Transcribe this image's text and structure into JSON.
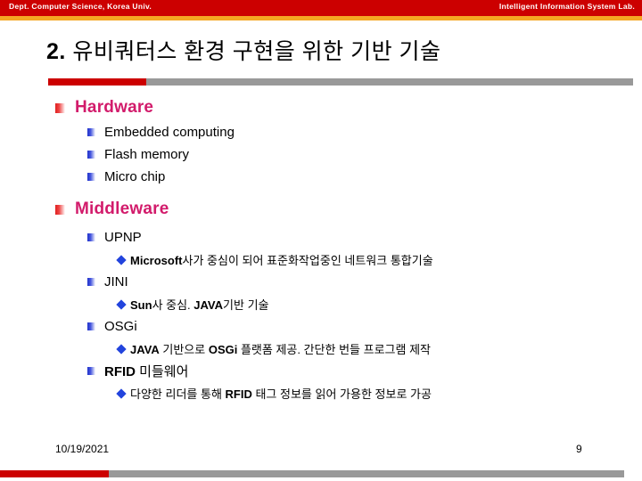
{
  "header": {
    "left_label": "Dept. Computer Science, Korea Univ.",
    "right_label": "Intelligent Information System Lab.",
    "bar_color": "#CC0000",
    "accent_color": "#F5A623"
  },
  "title": {
    "number": "2.",
    "text": "유비쿼터스 환경 구현을 위한 기반 기술"
  },
  "rule": {
    "red_color": "#CC0000",
    "gray_color": "#999999"
  },
  "content": {
    "hardware": {
      "label": "Hardware",
      "items": [
        {
          "label": "Embedded computing"
        },
        {
          "label": "Flash memory"
        },
        {
          "label": "Micro chip"
        }
      ]
    },
    "middleware": {
      "label": "Middleware",
      "items": [
        {
          "label": "UPNP",
          "detail_bold": "Microsoft",
          "detail_rest": "사가 중심이 되어 표준화작업중인 네트워크 통합기술"
        },
        {
          "label": "JINI",
          "detail_bold": "Sun",
          "detail_mid": "사 중심. ",
          "detail_bold2": "JAVA",
          "detail_rest": "기반 기술"
        },
        {
          "label": "OSGi",
          "detail_bold": "JAVA",
          "detail_mid": " 기반으로 ",
          "detail_bold2": "OSGi",
          "detail_rest": " 플랫폼 제공. 간단한 번들 프로그램 제작"
        },
        {
          "label_bold": "RFID",
          "label_rest": " 미들웨어",
          "detail_pre": "다양한 리더를 통해 ",
          "detail_bold": "RFID",
          "detail_rest": " 태그 정보를 읽어 가용한 정보로 가공"
        }
      ]
    }
  },
  "footer": {
    "date": "10/19/2021",
    "page_number": "9"
  },
  "colors": {
    "level1_text": "#D21B6B",
    "level1_bullet": "#E02020",
    "level2_bullet": "#2233CC",
    "level3_bullet": "#2244DD"
  }
}
